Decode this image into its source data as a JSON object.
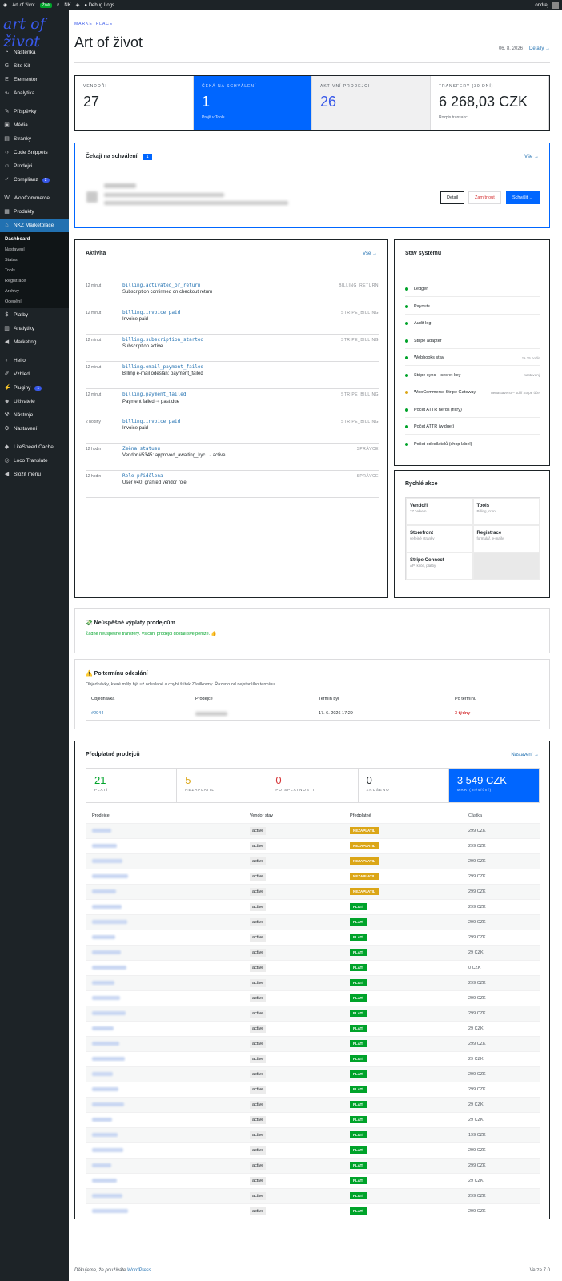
{
  "topbar": {
    "site": "Art of život",
    "badge": "Živě",
    "count": "NK",
    "debug": "Debug Logs",
    "user": "ondrej"
  },
  "sidebar": {
    "logo": "art of život",
    "items": [
      {
        "label": "Nástěnka",
        "icon": "dashboard-icon"
      },
      {
        "label": "Site Kit",
        "icon": "sitekit-icon"
      },
      {
        "label": "Elementor",
        "icon": "elementor-icon"
      },
      {
        "label": "Analytika",
        "icon": "analytics-icon"
      },
      {
        "label": "Příspěvky",
        "icon": "pin-icon"
      },
      {
        "label": "Média",
        "icon": "media-icon"
      },
      {
        "label": "Stránky",
        "icon": "pages-icon"
      },
      {
        "label": "Code Snippets",
        "icon": "code-icon"
      },
      {
        "label": "Prodejci",
        "icon": "vendors-icon"
      },
      {
        "label": "Complianz",
        "icon": "check-icon",
        "count": "2"
      },
      {
        "label": "WooCommerce",
        "icon": "woo-icon"
      },
      {
        "label": "Produkty",
        "icon": "products-icon"
      },
      {
        "label": "NKZ Marketplace",
        "icon": "store-icon"
      }
    ],
    "sub": [
      "Dashboard",
      "Nastavení",
      "Status",
      "Tools",
      "Registrace",
      "Archivy",
      "Ocenění"
    ],
    "items2": [
      {
        "label": "Platby",
        "icon": "payments-icon"
      },
      {
        "label": "Analytiky",
        "icon": "chart-icon"
      },
      {
        "label": "Marketing",
        "icon": "megaphone-icon"
      },
      {
        "label": "Hello",
        "icon": "hello-icon"
      },
      {
        "label": "Vzhled",
        "icon": "brush-icon"
      },
      {
        "label": "Pluginy",
        "icon": "plugin-icon",
        "count": "1"
      },
      {
        "label": "Uživatelé",
        "icon": "users-icon"
      },
      {
        "label": "Nástroje",
        "icon": "tools-icon"
      },
      {
        "label": "Nastavení",
        "icon": "settings-icon"
      },
      {
        "label": "LiteSpeed Cache",
        "icon": "litespeed-icon"
      },
      {
        "label": "Loco Translate",
        "icon": "loco-icon"
      },
      {
        "label": "Složit menu",
        "icon": "collapse-icon"
      }
    ]
  },
  "header": {
    "eyebrow": "MARKETPLACE",
    "title": "Art of život",
    "date": "06. 8. 2026",
    "details": "Detaily →"
  },
  "stats": [
    {
      "label": "VENDOŘI",
      "value": "27",
      "sub": ""
    },
    {
      "label": "ČEKÁ NA SCHVÁLENÍ",
      "value": "1",
      "sub": "Projít v Tools"
    },
    {
      "label": "AKTIVNÍ PRODEJCI",
      "value": "26",
      "sub": ""
    },
    {
      "label": "TRANSFERY (30 DNÍ)",
      "value": "6 268,03 CZK",
      "sub": "Rozpis transakcí"
    }
  ],
  "pending": {
    "title": "Čekají na schválení",
    "count": "1",
    "all": "Vše →",
    "btn_detail": "Detail",
    "btn_reject": "Zamítnout",
    "btn_approve": "Schválit →"
  },
  "activity": {
    "title": "Aktivita",
    "all": "Vše →",
    "rows": [
      {
        "time": "12 minut",
        "event": "billing.activated_or_return",
        "desc": "Subscription confirmed on checkout return",
        "src": "BILLING_RETURN"
      },
      {
        "time": "12 minut",
        "event": "billing.invoice_paid",
        "desc": "Invoice paid",
        "src": "STRIPE_BILLING"
      },
      {
        "time": "12 minut",
        "event": "billing.subscription_started",
        "desc": "Subscription active",
        "src": "STRIPE_BILLING"
      },
      {
        "time": "12 minut",
        "event": "billing.email_payment_failed",
        "desc": "Billing e-mail odeslán: payment_failed",
        "src": "—"
      },
      {
        "time": "12 minut",
        "event": "billing.payment_failed",
        "desc": "Payment failed ⇢ past due",
        "src": "STRIPE_BILLING"
      },
      {
        "time": "2 hodiny",
        "event": "billing.invoice_paid",
        "desc": "Invoice paid",
        "src": "STRIPE_BILLING"
      },
      {
        "time": "12 hodin",
        "event": "Změna statusu",
        "desc": "Vendor #5345: approved_awaiting_kyc → active",
        "src": "SPRÁVCE"
      },
      {
        "time": "12 hodin",
        "event": "Role přidělena",
        "desc": "User #40: granted vendor role",
        "src": "SPRÁVCE"
      }
    ]
  },
  "system": {
    "title": "Stav systému",
    "rows": [
      {
        "label": "Ledger",
        "note": "",
        "warn": false
      },
      {
        "label": "Payouts",
        "note": "",
        "warn": false
      },
      {
        "label": "Audit log",
        "note": "",
        "warn": false
      },
      {
        "label": "Stripe adaptér",
        "note": "",
        "warn": false
      },
      {
        "label": "Webhooks stav",
        "note": "za 15 hodin",
        "warn": false
      },
      {
        "label": "Stripe sync – secret key",
        "note": "nastavený",
        "warn": false
      },
      {
        "label": "WooCommerce Stripe Gateway",
        "note": "nenastaveno – sdílí Stripe účet",
        "warn": true
      },
      {
        "label": "Počet ATTR herds (filtry)",
        "note": "",
        "warn": false
      },
      {
        "label": "Počet ATTR (widget)",
        "note": "",
        "warn": false
      },
      {
        "label": "Počet odesílatelů (shop label)",
        "note": "",
        "warn": false
      }
    ]
  },
  "quick": {
    "title": "Rychlé akce",
    "cells": [
      {
        "t": "Vendoři",
        "s": "27 celkem"
      },
      {
        "t": "Tools",
        "s": "Billing, cron"
      },
      {
        "t": "Storefront",
        "s": "veřejné stránky"
      },
      {
        "t": "Registrace",
        "s": "formulář, e-maily"
      },
      {
        "t": "Stripe Connect",
        "s": "API klíče, platby"
      },
      {
        "t": "",
        "s": ""
      }
    ]
  },
  "failed": {
    "title": "💸 Neúspěšné výplaty prodejcům",
    "msg": "Žádné neúspěšné transfery. Všichni prodejci dostali své peníze. 👍"
  },
  "overdue": {
    "title": "⚠️ Po termínu odeslání",
    "msg": "Objednávky, které měly být už odeslané a chybí štítek Zásilkovny. Řazeno od nejstaršího termínu.",
    "headers": [
      "Objednávka",
      "Prodejce",
      "Termín byl",
      "Po termínu"
    ],
    "row": {
      "order": "#2944",
      "vendor": "",
      "due": "17. 6. 2026 17:29",
      "late": "3 týdny"
    }
  },
  "subs": {
    "title": "Předplatné prodejců",
    "settings": "Nastavení →",
    "stats": [
      {
        "v": "21",
        "l": "PLATÍ"
      },
      {
        "v": "5",
        "l": "NEZAPLATIL"
      },
      {
        "v": "0",
        "l": "PO SPLATNOSTI"
      },
      {
        "v": "0",
        "l": "ZRUŠENO"
      },
      {
        "v": "3 549 CZK",
        "l": "MRR (měsíční)"
      }
    ],
    "headers": [
      "Prodejce",
      "Vendor stav",
      "Předplatné",
      "Částka"
    ],
    "rows": [
      {
        "stav": "active",
        "sub": "NEZAPLATIL",
        "amt": "299 CZK",
        "late": true
      },
      {
        "stav": "active",
        "sub": "NEZAPLATIL",
        "amt": "299 CZK",
        "late": true
      },
      {
        "stav": "active",
        "sub": "NEZAPLATIL",
        "amt": "299 CZK",
        "late": true
      },
      {
        "stav": "active",
        "sub": "NEZAPLATIL",
        "amt": "299 CZK",
        "late": true
      },
      {
        "stav": "active",
        "sub": "NEZAPLATIL",
        "amt": "299 CZK",
        "late": true
      },
      {
        "stav": "active",
        "sub": "PLATÍ",
        "amt": "299 CZK",
        "late": false
      },
      {
        "stav": "active",
        "sub": "PLATÍ",
        "amt": "299 CZK",
        "late": false
      },
      {
        "stav": "active",
        "sub": "PLATÍ",
        "amt": "299 CZK",
        "late": false
      },
      {
        "stav": "active",
        "sub": "PLATÍ",
        "amt": "29 CZK",
        "late": false
      },
      {
        "stav": "active",
        "sub": "PLATÍ",
        "amt": "0 CZK",
        "late": false
      },
      {
        "stav": "active",
        "sub": "PLATÍ",
        "amt": "299 CZK",
        "late": false
      },
      {
        "stav": "active",
        "sub": "PLATÍ",
        "amt": "299 CZK",
        "late": false
      },
      {
        "stav": "active",
        "sub": "PLATÍ",
        "amt": "299 CZK",
        "late": false
      },
      {
        "stav": "active",
        "sub": "PLATÍ",
        "amt": "29 CZK",
        "late": false
      },
      {
        "stav": "active",
        "sub": "PLATÍ",
        "amt": "299 CZK",
        "late": false
      },
      {
        "stav": "active",
        "sub": "PLATÍ",
        "amt": "29 CZK",
        "late": false
      },
      {
        "stav": "active",
        "sub": "PLATÍ",
        "amt": "299 CZK",
        "late": false
      },
      {
        "stav": "active",
        "sub": "PLATÍ",
        "amt": "299 CZK",
        "late": false
      },
      {
        "stav": "active",
        "sub": "PLATÍ",
        "amt": "29 CZK",
        "late": false
      },
      {
        "stav": "active",
        "sub": "PLATÍ",
        "amt": "29 CZK",
        "late": false
      },
      {
        "stav": "active",
        "sub": "PLATÍ",
        "amt": "199 CZK",
        "late": false
      },
      {
        "stav": "active",
        "sub": "PLATÍ",
        "amt": "299 CZK",
        "late": false
      },
      {
        "stav": "active",
        "sub": "PLATÍ",
        "amt": "299 CZK",
        "late": false
      },
      {
        "stav": "active",
        "sub": "PLATÍ",
        "amt": "29 CZK",
        "late": false
      },
      {
        "stav": "active",
        "sub": "PLATÍ",
        "amt": "299 CZK",
        "late": false
      },
      {
        "stav": "active",
        "sub": "PLATÍ",
        "amt": "299 CZK",
        "late": false
      }
    ]
  },
  "footer": {
    "thanks": "Děkujeme, že používáte",
    "wp": "WordPress",
    "ver": "Verze 7.0"
  }
}
